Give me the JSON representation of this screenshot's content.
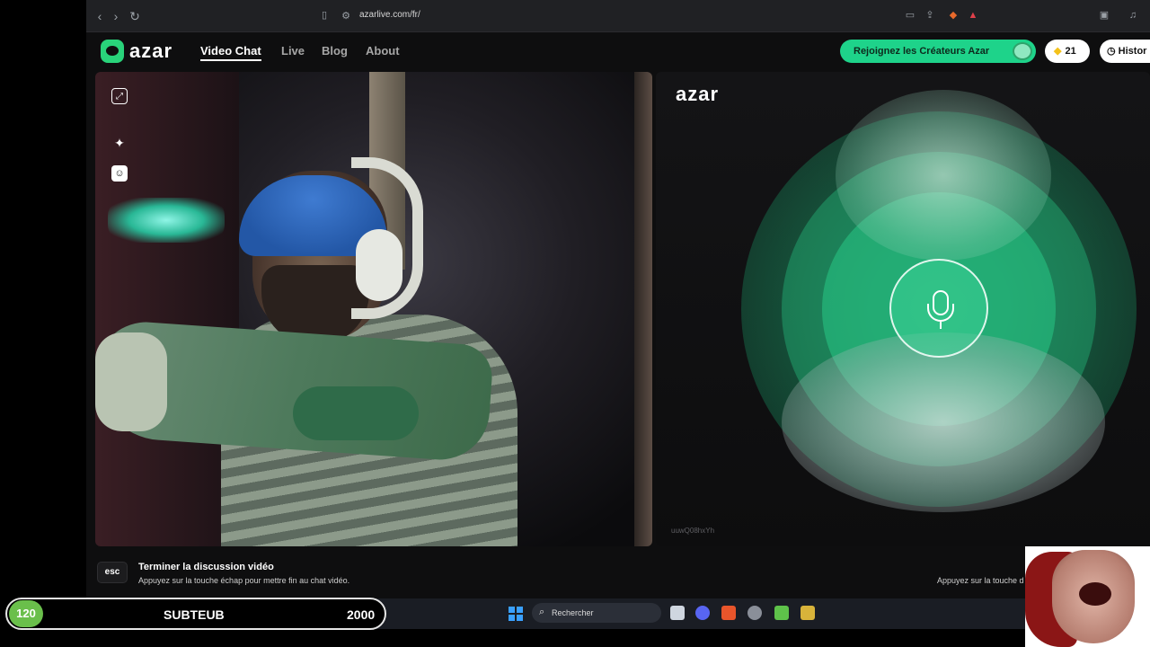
{
  "browser": {
    "url": "azarlive.com/fr/"
  },
  "header": {
    "logo_text": "azar",
    "nav": [
      "Video Chat",
      "Live",
      "Blog",
      "About"
    ],
    "creators_button": "Rejoignez les Créateurs Azar",
    "gems_count": "21",
    "history_button": "Histor"
  },
  "video": {
    "remote_logo": "azar",
    "remote_id": "uuwQ08hxYh"
  },
  "footer_hint": {
    "esc_key": "esc",
    "title": "Terminer la discussion vidéo",
    "subtitle": "Appuyez sur la touche échap pour mettre fin au chat vidéo.",
    "right_hint": "Appuyez sur la touche d"
  },
  "taskbar": {
    "search_placeholder": "Rechercher"
  },
  "stream_overlay": {
    "current": "120",
    "label": "SUBTEUB",
    "goal": "2000"
  },
  "colors": {
    "brand_green": "#1ed38a",
    "background": "#0e0e0f",
    "sub_green": "#6abf4b"
  }
}
